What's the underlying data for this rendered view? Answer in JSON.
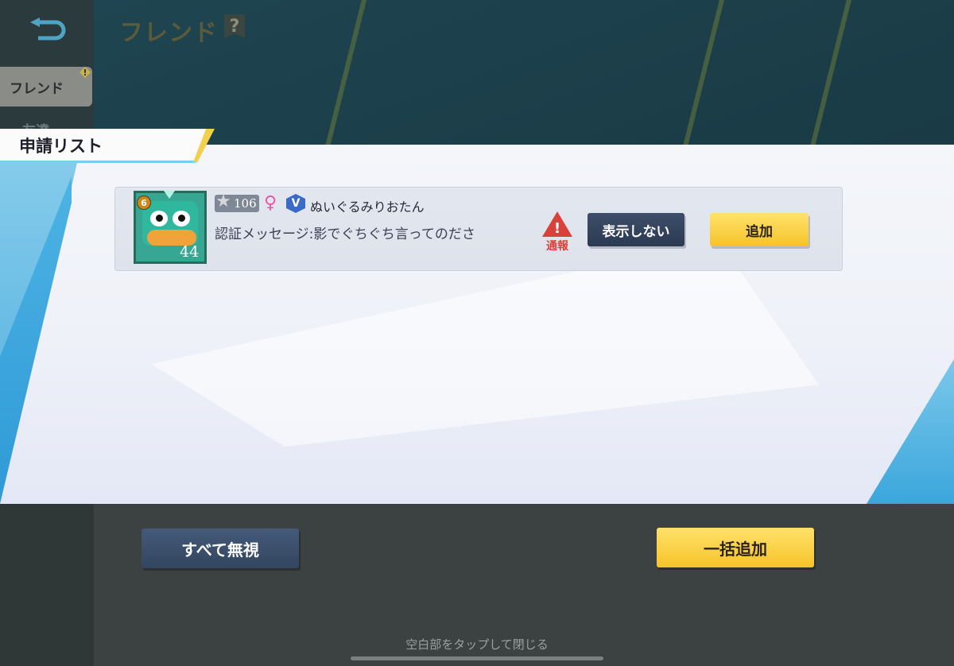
{
  "header": {
    "back_icon": "back-arrow-icon",
    "title": "フレンド",
    "help_icon": "?"
  },
  "sidebar": {
    "active_tab": "フレンド",
    "active_tab_badge": "!",
    "second_tab": "友達"
  },
  "modal": {
    "section_title": "申請リスト",
    "requests": [
      {
        "avatar_rank": "6",
        "avatar_level": "44",
        "star_level": "106",
        "gender_icon": "♀",
        "verified_badge": "V",
        "player_name": "ぬいぐるみりおたん",
        "message": "認証メッセージ:影でぐちぐち言ってのださ",
        "report_icon": "!",
        "report_label": "通報",
        "hide_label": "表示しない",
        "add_label": "追加"
      }
    ]
  },
  "footer": {
    "ignore_all_label": "すべて無視",
    "add_all_label": "一括追加",
    "close_hint": "空白部をタップして閉じる"
  },
  "colors": {
    "accent_yellow": "#f6c32a",
    "button_navy": "#33465f",
    "report_red": "#d9423a",
    "gender_pink": "#e45aa6"
  }
}
